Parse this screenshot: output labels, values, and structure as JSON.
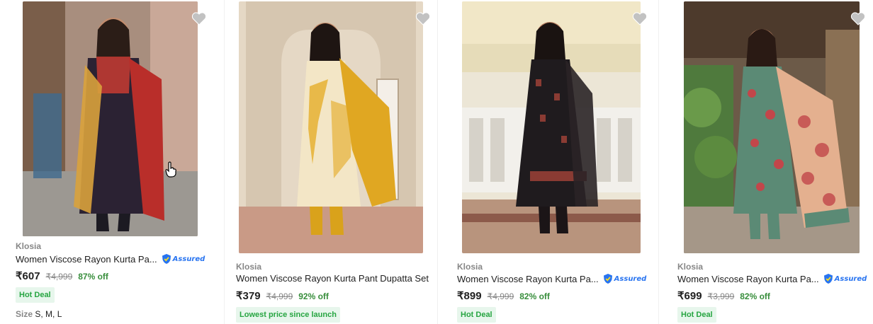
{
  "products": [
    {
      "brand": "Klosia",
      "title": "Women Viscose Rayon Kurta Pa...",
      "assured": true,
      "assured_label": "Assured",
      "price": "₹607",
      "mrp": "₹4,999",
      "discount": "87% off",
      "tag": "Hot Deal",
      "size_label": "Size",
      "sizes": "S, M, L",
      "colors": {
        "bg": "#b09585",
        "dress": "#2b2233",
        "accent": "#c73b32",
        "dupatta": "#d9a23c"
      }
    },
    {
      "brand": "Klosia",
      "title": "Women Viscose Rayon Kurta Pant Dupatta Set",
      "assured": false,
      "price": "₹379",
      "mrp": "₹4,999",
      "discount": "92% off",
      "tag": "Lowest price since launch",
      "colors": {
        "bg": "#e8ddcf",
        "dress": "#f3e6c6",
        "accent": "#d9a21b",
        "dupatta": "#e0a722"
      }
    },
    {
      "brand": "Klosia",
      "title": "Women Viscose Rayon Kurta Pa...",
      "assured": true,
      "assured_label": "Assured",
      "price": "₹899",
      "mrp": "₹4,999",
      "discount": "82% off",
      "tag": "Hot Deal",
      "colors": {
        "bg": "#ebe6da",
        "dress": "#1f1b1e",
        "accent": "#8a3b33",
        "dupatta": "#2a2326"
      }
    },
    {
      "brand": "Klosia",
      "title": "Women Viscose Rayon Kurta Pa...",
      "assured": true,
      "assured_label": "Assured",
      "price": "₹699",
      "mrp": "₹3,999",
      "discount": "82% off",
      "tag": "Hot Deal",
      "colors": {
        "bg": "#6f7d55",
        "dress": "#5b8a75",
        "accent": "#c2464a",
        "dupatta": "#e4b08f"
      }
    }
  ],
  "icons": {
    "wishlist": "heart-icon",
    "assured": "assured-shield-icon",
    "cursor": "hand-cursor-icon"
  }
}
